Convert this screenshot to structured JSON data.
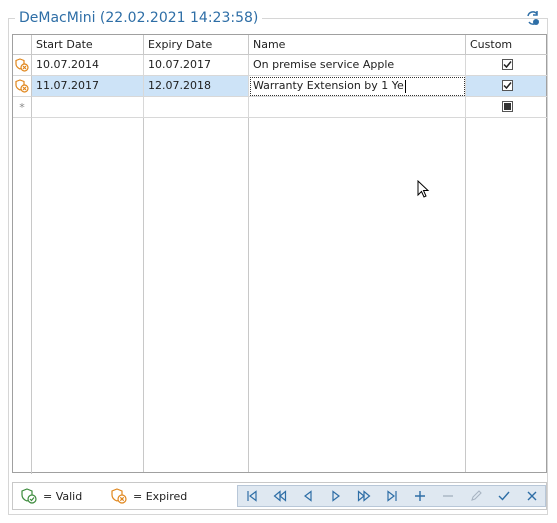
{
  "title": "DeMacMini (22.02.2021 14:23:58)",
  "columns": [
    "Start Date",
    "Expiry Date",
    "Name",
    "Custom"
  ],
  "rows": [
    {
      "status_icon": "expired-warranty-icon",
      "start": "10.07.2014",
      "expiry": "10.07.2017",
      "name": "On premise service Apple",
      "custom": true,
      "selected": false
    },
    {
      "status_icon": "expired-warranty-icon",
      "start": "11.07.2017",
      "expiry": "12.07.2018",
      "name": "Warranty Extension by 1 Ye",
      "custom": true,
      "selected": true
    }
  ],
  "new_row_marker": "*",
  "legend": {
    "valid": "= Valid",
    "expired": "= Expired"
  },
  "navigator": [
    "first-icon",
    "prev-page-icon",
    "prev-icon",
    "next-icon",
    "next-page-icon",
    "last-icon",
    "append-icon",
    "delete-icon",
    "edit-icon",
    "end-edit-icon",
    "cancel-edit-icon"
  ],
  "colors": {
    "title": "#2e6ea6",
    "selected_row": "#cde3f7",
    "valid_icon": "#3a8a3a",
    "expired_icon": "#e0861c",
    "nav_icon": "#2e6ea6"
  }
}
